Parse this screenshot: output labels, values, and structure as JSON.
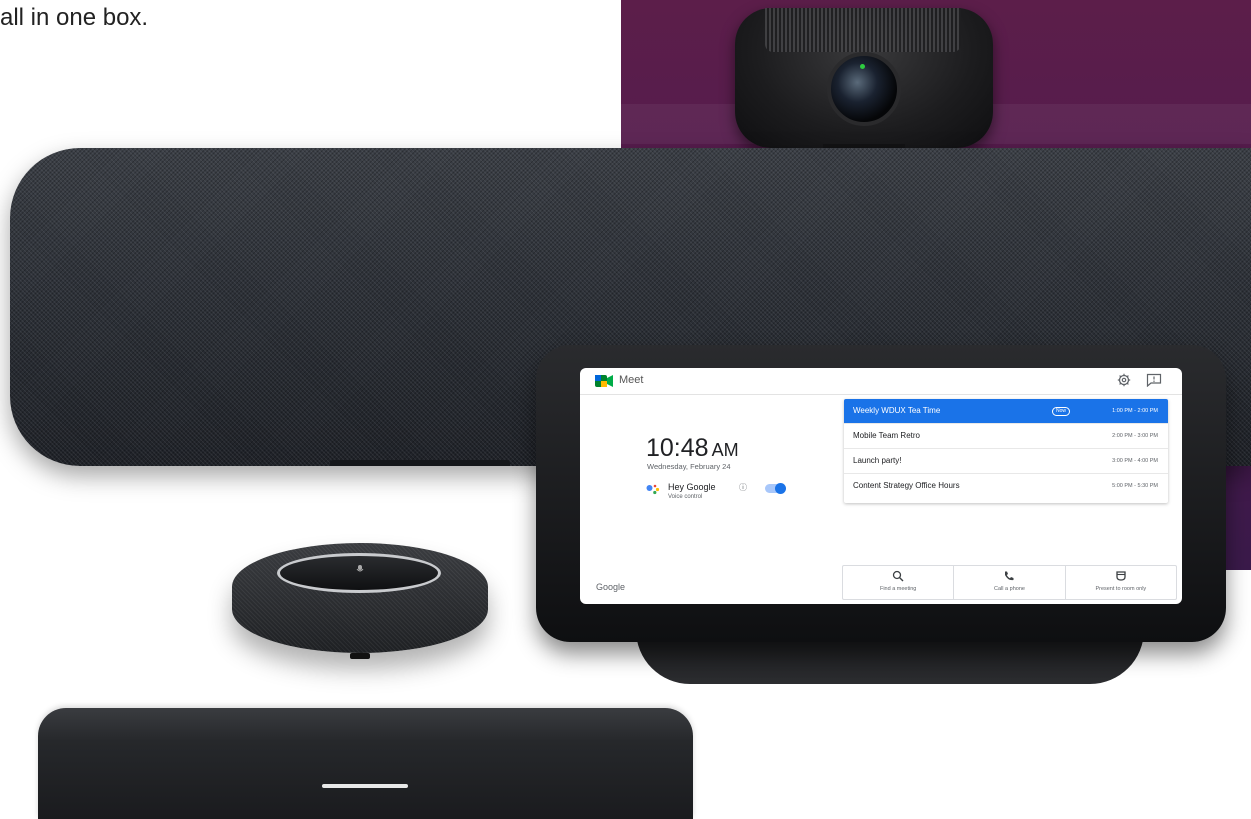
{
  "caption": "all in one box.",
  "tablet": {
    "app_name": "Meet",
    "time": "10:48",
    "ampm": "AM",
    "date": "Wednesday, February 24",
    "assistant": {
      "label": "Hey Google",
      "info_symbol": "ⓘ",
      "sublabel": "Voice control",
      "toggle_on": true
    },
    "footer_brand": "Google",
    "events": [
      {
        "title": "Weekly WDUX Tea Time",
        "time": "1:00 PM - 2:00 PM",
        "badge": "Now",
        "active": true
      },
      {
        "title": "Mobile Team Retro",
        "time": "2:00 PM - 3:00 PM",
        "active": false
      },
      {
        "title": "Launch party!",
        "time": "3:00 PM - 4:00 PM",
        "active": false
      },
      {
        "title": "Content Strategy Office Hours",
        "time": "5:00 PM - 5:30 PM",
        "active": false
      }
    ],
    "actions": [
      {
        "label": "Find a meeting",
        "icon": "search-icon"
      },
      {
        "label": "Call a phone",
        "icon": "phone-icon"
      },
      {
        "label": "Present to room only",
        "icon": "present-icon"
      }
    ],
    "icons": {
      "settings": "gear-icon",
      "feedback": "feedback-icon"
    }
  },
  "colors": {
    "accent": "#1a73e8",
    "backdrop": "#5c1e4a",
    "device_dark": "#2c3037"
  },
  "speakerphone": {
    "mic_symbol": "🎤"
  }
}
